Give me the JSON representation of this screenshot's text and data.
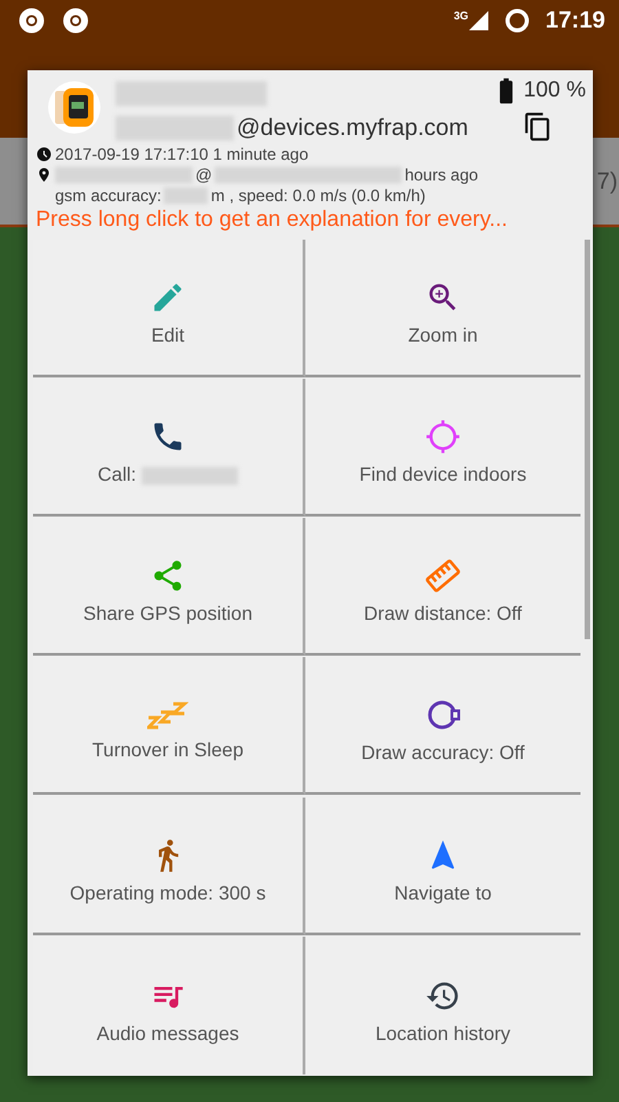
{
  "status_bar": {
    "network": "3G",
    "time": "17:19"
  },
  "background": {
    "counter": "7)"
  },
  "device": {
    "battery": "100 %",
    "email_suffix": "@devices.myfrap.com",
    "last_seen": "2017-09-19 17:17:10 1 minute ago",
    "position_at": "@",
    "position_age": "hours ago",
    "gsm_label": "gsm accuracy:",
    "gsm_rest": "m , speed: 0.0 m/s (0.0 km/h)"
  },
  "hint": "Press long click to get an explanation for every...",
  "actions": [
    {
      "kind": "edit",
      "label": "Edit",
      "color": "#26a69a"
    },
    {
      "kind": "zoom",
      "label": "Zoom in",
      "color": "#6a1b7a"
    },
    {
      "kind": "call",
      "label": "Call:",
      "redacted": true,
      "color": "#1b3a5c"
    },
    {
      "kind": "target",
      "label": "Find device indoors",
      "color": "#e040fb"
    },
    {
      "kind": "share",
      "label": "Share GPS position",
      "color": "#1faa00"
    },
    {
      "kind": "ruler",
      "label": "Draw distance: Off",
      "color": "#ff6d00"
    },
    {
      "kind": "sleep",
      "label": "Turnover in Sleep",
      "color": "#f9a825"
    },
    {
      "kind": "accuracy",
      "label": "Draw accuracy: Off",
      "color": "#5e35b1"
    },
    {
      "kind": "walk",
      "label": "Operating mode: 300 s",
      "color": "#a0520d"
    },
    {
      "kind": "navigate",
      "label": "Navigate to",
      "color": "#1e6fff"
    },
    {
      "kind": "audio",
      "label": "Audio messages",
      "color": "#d81b60"
    },
    {
      "kind": "history",
      "label": "Location history",
      "color": "#37414b"
    }
  ]
}
